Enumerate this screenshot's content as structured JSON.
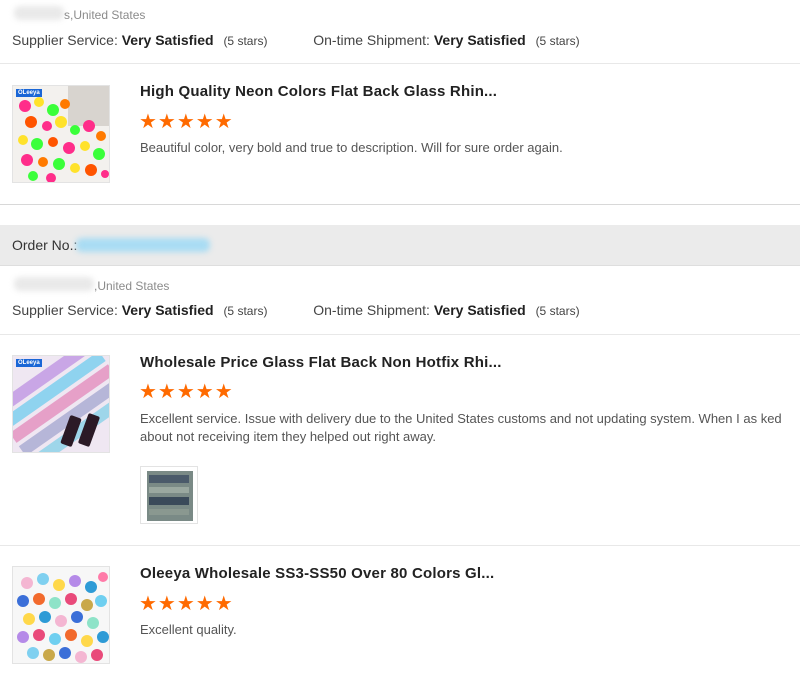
{
  "reviews": [
    {
      "location": "s,United States",
      "supplier_service_label": "Supplier Service:",
      "supplier_service_value": "Very Satisfied",
      "supplier_service_stars": "(5 stars)",
      "shipment_label": "On-time Shipment:",
      "shipment_value": "Very Satisfied",
      "shipment_stars": "(5 stars)",
      "items": [
        {
          "title": "High Quality Neon Colors Flat Back Glass Rhin...",
          "rating": 5,
          "stars": "★★★★★",
          "comment": "Beautiful color, very bold and true to description. Will for sure order again.",
          "brand": "OLeeya"
        }
      ]
    },
    {
      "order_label": "Order No.:",
      "location": ",United States",
      "supplier_service_label": "Supplier Service:",
      "supplier_service_value": "Very Satisfied",
      "supplier_service_stars": "(5 stars)",
      "shipment_label": "On-time Shipment:",
      "shipment_value": "Very Satisfied",
      "shipment_stars": "(5 stars)",
      "items": [
        {
          "title": "Wholesale Price Glass Flat Back Non Hotfix Rhi...",
          "rating": 5,
          "stars": "★★★★★",
          "comment": "Excellent service. Issue with delivery due to the United States customs and not updating system. When I as ked about not receiving item they helped out right away.",
          "brand": "OLeeya"
        },
        {
          "title": "Oleeya Wholesale SS3-SS50 Over 80 Colors Gl...",
          "rating": 5,
          "stars": "★★★★★",
          "comment": "Excellent quality."
        }
      ]
    }
  ],
  "colors": {
    "star": "#ff6a00",
    "divider": "#e8e8e8",
    "order_bar": "#ebebeb"
  }
}
